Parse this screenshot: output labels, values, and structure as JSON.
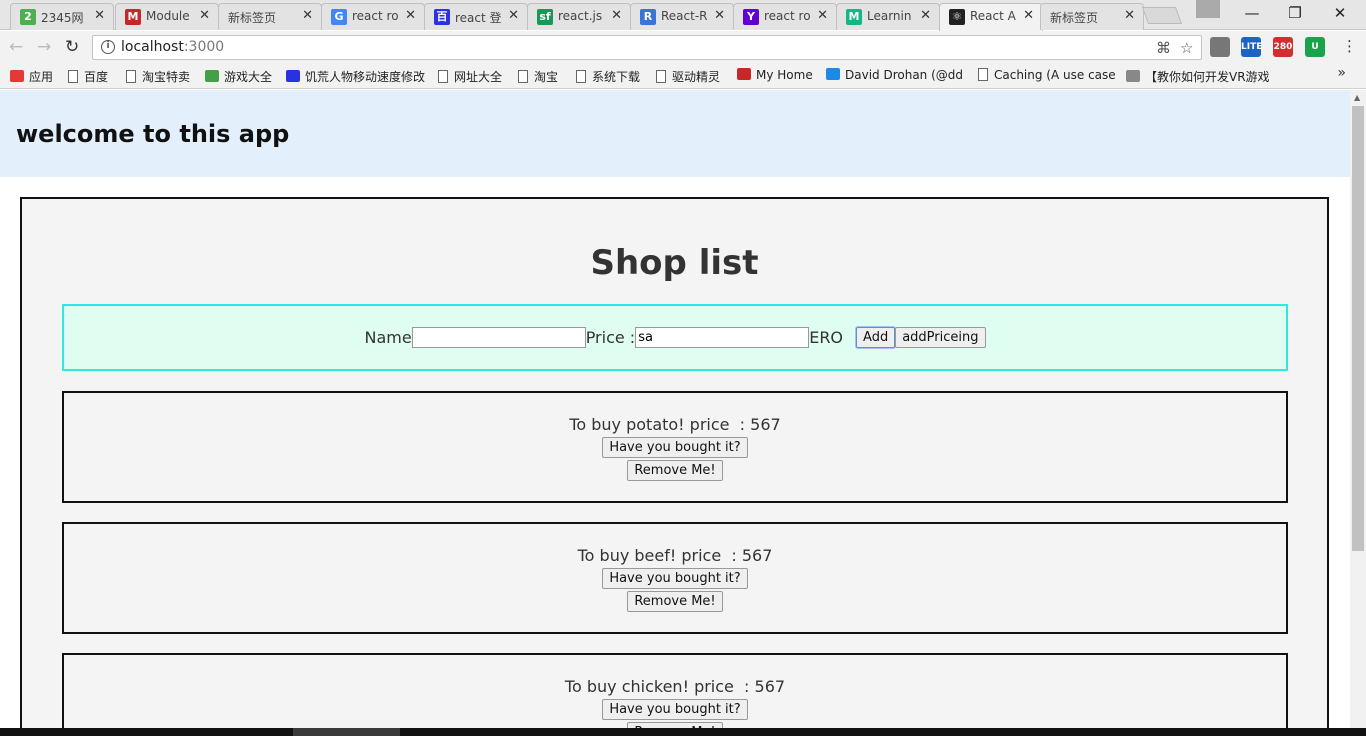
{
  "browser": {
    "tabs": [
      {
        "title": "2345网",
        "color": "#4caf50",
        "glyph": "2"
      },
      {
        "title": "Module",
        "color": "#c62828",
        "glyph": "M"
      },
      {
        "title": "新标签页",
        "color": "",
        "glyph": ""
      },
      {
        "title": "react ro",
        "color": "#4285f4",
        "glyph": "G"
      },
      {
        "title": "react 登",
        "color": "#2932e1",
        "glyph": "百"
      },
      {
        "title": "react.js",
        "color": "#159957",
        "glyph": "sf"
      },
      {
        "title": "React-R",
        "color": "#3b73d8",
        "glyph": "R"
      },
      {
        "title": "react ro",
        "color": "#6001d2",
        "glyph": "Y"
      },
      {
        "title": "Learnin",
        "color": "#12b886",
        "glyph": "M"
      },
      {
        "title": "React A",
        "color": "#222",
        "glyph": "⚛"
      },
      {
        "title": "新标签页",
        "color": "",
        "glyph": ""
      }
    ],
    "close_glyph": "✕",
    "url_host": "localhost",
    "url_port": ":3000",
    "window_controls": {
      "minimize": "—",
      "restore": "❐",
      "close": "✕"
    }
  },
  "bookmarks": [
    {
      "label": "应用",
      "icon": "apps-icon",
      "color": "#e53935"
    },
    {
      "label": "百度",
      "icon": "page-icon",
      "color": ""
    },
    {
      "label": "淘宝特卖",
      "icon": "page-icon",
      "color": ""
    },
    {
      "label": "游戏大全",
      "icon": "gamepad-icon",
      "color": "#43a047"
    },
    {
      "label": "饥荒人物移动速度修改",
      "icon": "paw-icon",
      "color": "#2932e1"
    },
    {
      "label": "网址大全",
      "icon": "page-icon",
      "color": ""
    },
    {
      "label": "淘宝",
      "icon": "page-icon",
      "color": ""
    },
    {
      "label": "系统下载",
      "icon": "page-icon",
      "color": ""
    },
    {
      "label": "驱动精灵",
      "icon": "page-icon",
      "color": ""
    },
    {
      "label": "My Home",
      "icon": "home-icon",
      "color": "#c62828"
    },
    {
      "label": "David Drohan (@dd",
      "icon": "stack-icon",
      "color": "#1e88e5"
    },
    {
      "label": "Caching (A use case",
      "icon": "page-icon",
      "color": ""
    },
    {
      "label": "【教你如何开发VR游戏",
      "icon": "bird-icon",
      "color": "#888"
    }
  ],
  "extensions": [
    {
      "name": "gamepad-ext-icon",
      "label": "",
      "color": "#777"
    },
    {
      "name": "lite-ext-icon",
      "label": "LITE",
      "color": "#1e63c4"
    },
    {
      "name": "gmail-ext-icon",
      "label": "280",
      "color": "#d32f2f"
    },
    {
      "name": "shield-ext-icon",
      "label": "U",
      "color": "#1aa34a"
    }
  ],
  "page": {
    "header_title": "welcome to this app",
    "shop_title": "Shop list",
    "form": {
      "name_label": "Name",
      "name_value": "",
      "price_label": "Price :",
      "price_value": "sa",
      "suffix_label": "ERO",
      "add_button": "Add",
      "add_pricing_button": "addPriceing"
    },
    "items": [
      {
        "text": "To buy potato! price  : 567",
        "bought_button": "Have you bought it?",
        "remove_button": "Remove Me!"
      },
      {
        "text": "To buy beef! price  : 567",
        "bought_button": "Have you bought it?",
        "remove_button": "Remove Me!"
      },
      {
        "text": "To buy chicken! price  : 567",
        "bought_button": "Have you bought it?",
        "remove_button": "Remove Me!"
      }
    ]
  }
}
